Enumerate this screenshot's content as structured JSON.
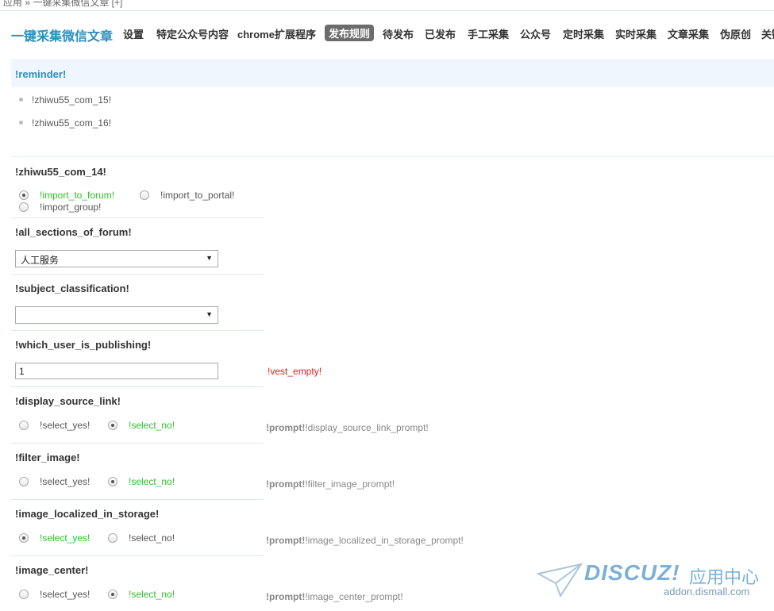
{
  "breadcrumb": "应用 »  一键采集微信文章 [+]",
  "app_title": "一键采集微信文章",
  "nav": [
    "设置",
    "特定公众号内容",
    "chrome扩展程序",
    "发布规则",
    "待发布",
    "已发布",
    "手工采集",
    "公众号",
    "定时采集",
    "实时采集",
    "文章采集",
    "伪原创",
    "关键"
  ],
  "nav_active": "发布规则",
  "reminder": {
    "title": "!reminder!",
    "items": [
      "!zhiwu55_com_15!",
      "!zhiwu55_com_16!"
    ]
  },
  "import_target": {
    "label": "!zhiwu55_com_14!",
    "options": [
      "!import_to_forum!",
      "!import_to_portal!",
      "!import_group!"
    ],
    "selected": "!import_to_forum!"
  },
  "forum_section": {
    "label": "!all_sections_of_forum!",
    "value": "人工服务"
  },
  "subject_class": {
    "label": "!subject_classification!",
    "value": ""
  },
  "publisher": {
    "label": "!which_user_is_publishing!",
    "value": "1",
    "error": "!vest_empty!"
  },
  "yes_no": {
    "yes": "!select_yes!",
    "no": "!select_no!"
  },
  "prompt_prefix": "!prompt!",
  "options": [
    {
      "label": "!display_source_link!",
      "selected": "no",
      "prompt": "!display_source_link_prompt!"
    },
    {
      "label": "!filter_image!",
      "selected": "no",
      "prompt": "!filter_image_prompt!"
    },
    {
      "label": "!image_localized_in_storage!",
      "selected": "yes",
      "prompt": "!image_localized_in_storage_prompt!"
    },
    {
      "label": "!image_center!",
      "selected": "no",
      "prompt": "!image_center_prompt!"
    }
  ],
  "watermark": {
    "brand": "DISCUZ!",
    "cn": "应用中心",
    "url": "addon.dismall.com"
  },
  "colors": {
    "accent": "#2a8fbd",
    "checked_text": "#2bbf2b",
    "error": "#e02020",
    "active_tab": "#6c6c6c"
  }
}
